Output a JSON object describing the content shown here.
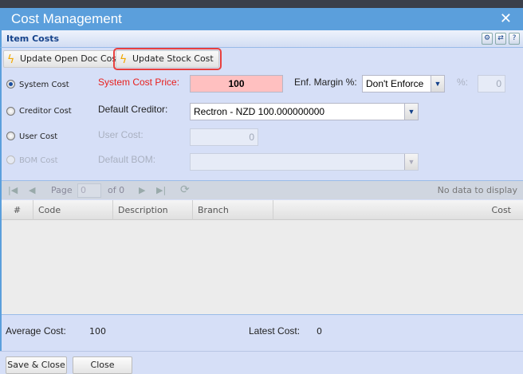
{
  "window": {
    "title": "Cost Management",
    "close_icon": "close-icon"
  },
  "panel": {
    "title": "Item Costs",
    "tools": [
      "gear-icon",
      "refresh-icon",
      "help-icon"
    ]
  },
  "toolbar": {
    "update_open_doc": "Update Open Doc Cost",
    "update_stock": "Update Stock Cost",
    "icon": "lightning-icon"
  },
  "form": {
    "system_cost": {
      "radio": "System Cost",
      "selected": true,
      "label": "System Cost Price:",
      "value": "100",
      "highlight": "#ffc0c0"
    },
    "enf_margin": {
      "label": "Enf. Margin %:",
      "value": "Don't Enforce",
      "pct_label": "%:",
      "pct_value": "0"
    },
    "creditor_cost": {
      "radio": "Creditor Cost",
      "label": "Default Creditor:",
      "value": "Rectron - NZD 100.000000000"
    },
    "user_cost": {
      "radio": "User Cost",
      "label": "User Cost:",
      "value": "0"
    },
    "bom_cost": {
      "radio": "BOM Cost",
      "label": "Default BOM:",
      "value": ""
    }
  },
  "pager": {
    "page_label": "Page",
    "page_value": "0",
    "of_label": "of 0",
    "status": "No data to display"
  },
  "grid": {
    "columns": [
      "#",
      "Code",
      "Description",
      "Branch",
      "Cost"
    ],
    "rows": []
  },
  "summary": {
    "avg_label": "Average Cost:",
    "avg_value": "100",
    "latest_label": "Latest Cost:",
    "latest_value": "0"
  },
  "buttons": {
    "save_close": "Save & Close",
    "close": "Close"
  }
}
